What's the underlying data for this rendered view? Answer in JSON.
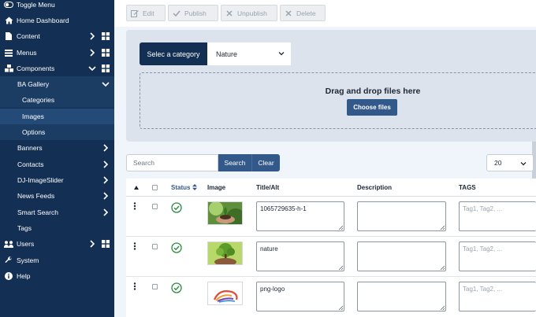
{
  "sidebar": {
    "items": [
      {
        "label": "Toggle Menu",
        "icon": "toggle-icon"
      },
      {
        "label": "Home Dashboard",
        "icon": "home-icon"
      },
      {
        "label": "Content",
        "icon": "file-icon"
      },
      {
        "label": "Menus",
        "icon": "list-icon"
      },
      {
        "label": "Components",
        "icon": "cubes-icon"
      },
      {
        "label": "BA Gallery"
      },
      {
        "label": "Categories"
      },
      {
        "label": "Images"
      },
      {
        "label": "Options"
      },
      {
        "label": "Banners"
      },
      {
        "label": "Contacts"
      },
      {
        "label": "DJ-ImageSlider"
      },
      {
        "label": "News Feeds"
      },
      {
        "label": "Smart Search"
      },
      {
        "label": "Tags"
      },
      {
        "label": "Users",
        "icon": "users-icon"
      },
      {
        "label": "System",
        "icon": "wrench-icon"
      },
      {
        "label": "Help",
        "icon": "info-icon"
      }
    ]
  },
  "toolbar": {
    "edit": "Edit",
    "publish": "Publish",
    "unpublish": "Unpublish",
    "delete": "Delete"
  },
  "upload": {
    "category_label": "Selec a category",
    "category_value": "Nature",
    "drop_text": "Drag and drop files here",
    "choose_button": "Choose files"
  },
  "search": {
    "placeholder": "Search",
    "search_button": "Search",
    "clear_button": "Clear",
    "limit": "20"
  },
  "table": {
    "headers": {
      "status": "Status",
      "image": "Image",
      "title": "Title/Alt",
      "description": "Description",
      "tags": "TAGS"
    },
    "rows": [
      {
        "title": "1065729635-h-1",
        "description": "",
        "tags_placeholder": "Tag1, Tag2, ...",
        "thumb": "hands-plant"
      },
      {
        "title": "nature",
        "description": "",
        "tags_placeholder": "Tag1, Tag2, ...",
        "thumb": "tree-globe"
      },
      {
        "title": "png-logo",
        "description": "",
        "tags_placeholder": "Tag1, Tag2, ...",
        "thumb": "swirl-logo"
      }
    ]
  },
  "colors": {
    "sidebar_bg": "#132f53",
    "primary": "#33588a",
    "success": "#2a8a3e"
  }
}
